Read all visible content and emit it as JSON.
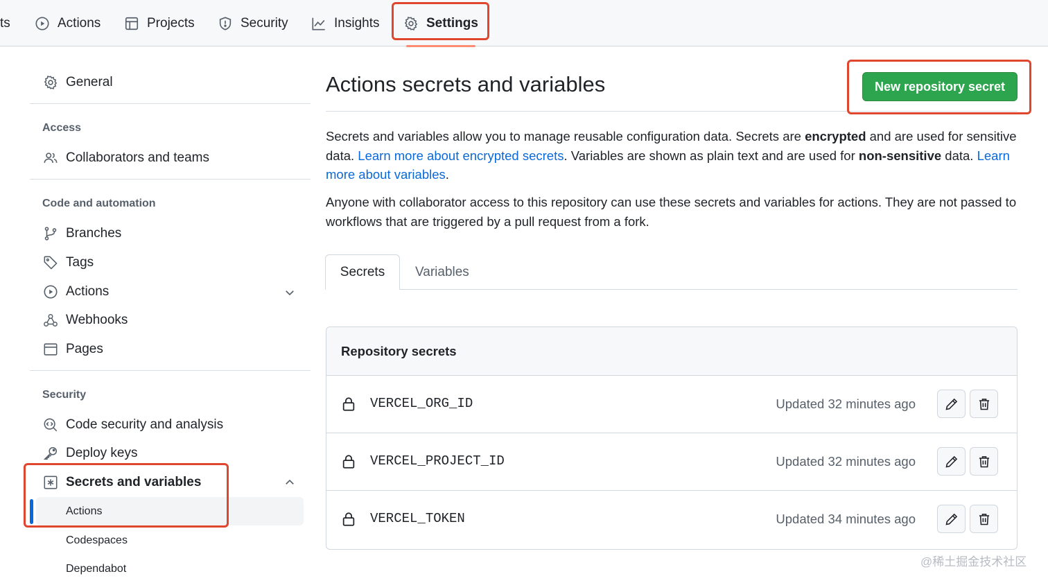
{
  "top_tabs": {
    "partial": "ts",
    "actions": "Actions",
    "projects": "Projects",
    "security": "Security",
    "insights": "Insights",
    "settings": "Settings"
  },
  "sidebar": {
    "general": "General",
    "access_heading": "Access",
    "collaborators": "Collaborators and teams",
    "code_heading": "Code and automation",
    "branches": "Branches",
    "tags": "Tags",
    "actions": "Actions",
    "webhooks": "Webhooks",
    "pages": "Pages",
    "security_heading": "Security",
    "code_security": "Code security and analysis",
    "deploy_keys": "Deploy keys",
    "secrets_vars": "Secrets and variables",
    "sub_actions": "Actions",
    "sub_codespaces": "Codespaces",
    "sub_dependabot": "Dependabot"
  },
  "main": {
    "title": "Actions secrets and variables",
    "new_secret_button": "New repository secret",
    "para1": {
      "t1": "Secrets and variables allow you to manage reusable configuration data. Secrets are ",
      "b1": "encrypted",
      "t2": " and are used for sensitive data. ",
      "link1": "Learn more about encrypted secrets",
      "t3": ". Variables are shown as plain text and are used for ",
      "b2": "non-sensitive",
      "t4": " data. ",
      "link2": "Learn more about variables",
      "t5": "."
    },
    "para2": "Anyone with collaborator access to this repository can use these secrets and variables for actions. They are not passed to workflows that are triggered by a pull request from a fork.",
    "tabs": {
      "secrets": "Secrets",
      "variables": "Variables"
    },
    "repo_secrets": {
      "heading": "Repository secrets",
      "rows": [
        {
          "name": "VERCEL_ORG_ID",
          "updated": "Updated 32 minutes ago"
        },
        {
          "name": "VERCEL_PROJECT_ID",
          "updated": "Updated 32 minutes ago"
        },
        {
          "name": "VERCEL_TOKEN",
          "updated": "Updated 34 minutes ago"
        }
      ]
    }
  },
  "watermark": "@稀土掘金技术社区",
  "colors": {
    "accent_green": "#2da44e",
    "link_blue": "#0969da",
    "highlight_red": "#e0452d",
    "tab_underline": "#fd8c73"
  }
}
